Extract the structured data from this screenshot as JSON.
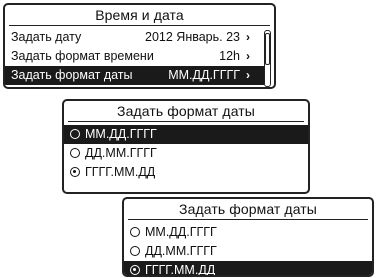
{
  "screen1": {
    "title": "Время и дата",
    "items": [
      {
        "label": "Задать дату",
        "value": "2012 Январь. 23"
      },
      {
        "label": "Задать формат времени",
        "value": "12h"
      },
      {
        "label": "Задать формат даты",
        "value": "ММ.ДД.ГГГГ"
      }
    ],
    "chevron": "›",
    "selected_index": 2
  },
  "screen2": {
    "title": "Задать формат даты",
    "options": [
      {
        "label": "ММ.ДД.ГГГГ"
      },
      {
        "label": "ДД.ММ.ГГГГ"
      },
      {
        "label": "ГГГГ.ММ.ДД"
      }
    ],
    "highlighted_index": 0,
    "checked_index": 2
  },
  "screen3": {
    "title": "Задать формат даты",
    "options": [
      {
        "label": "ММ.ДД.ГГГГ"
      },
      {
        "label": "ДД.ММ.ГГГГ"
      },
      {
        "label": "ГГГГ.ММ.ДД"
      }
    ],
    "highlighted_index": 2,
    "checked_index": 2
  }
}
